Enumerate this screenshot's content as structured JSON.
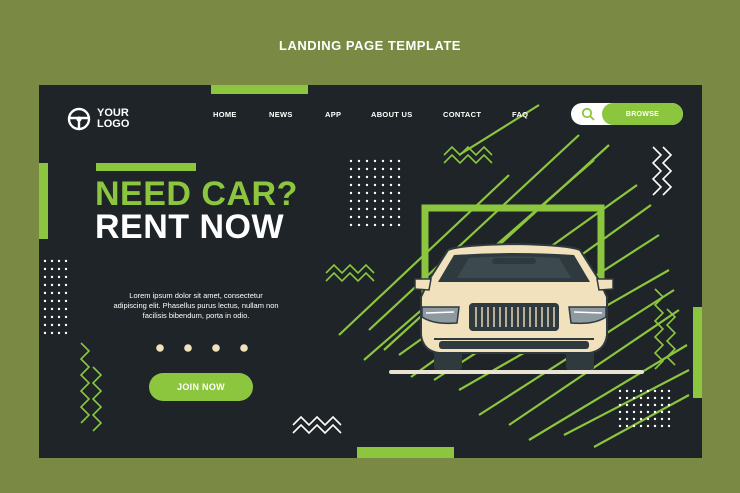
{
  "page": {
    "heading": "LANDING PAGE TEMPLATE"
  },
  "logo": {
    "line1": "YOUR",
    "line2": "LOGO",
    "icon": "steering-wheel-icon"
  },
  "nav": {
    "items": [
      "HOME",
      "NEWS",
      "APP",
      "ABOUT US",
      "CONTACT",
      "FAQ"
    ]
  },
  "search": {
    "icon": "search-icon",
    "button_label": "BROWSE"
  },
  "hero": {
    "line1": "NEED CAR?",
    "line2": "RENT NOW",
    "description_1": "Lorem ipsum dolor sit amet, consectetur",
    "description_2": "adipiscing elit. Phasellus purus lectus, nullam non",
    "description_3": "facilisis bibendum, porta in odio.",
    "cta_label": "JOIN NOW"
  },
  "colors": {
    "page_bg": "#7a8a45",
    "panel_bg": "#1e2427",
    "accent": "#8cc63f",
    "car_body": "#f2e1bd",
    "text": "#ffffff"
  }
}
